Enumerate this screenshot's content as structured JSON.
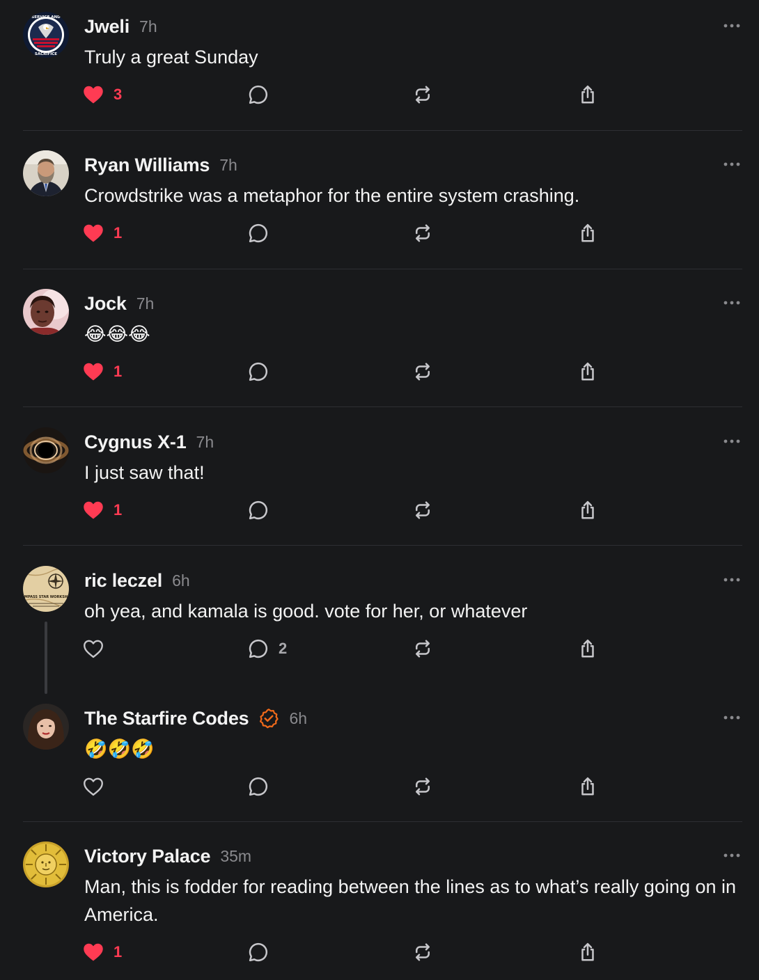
{
  "posts": [
    {
      "author": "Jweli",
      "time": "7h",
      "text": "Truly a great Sunday",
      "avatar_icon": "service-and-sacrifice-eagle-badge",
      "avatar_text": "SERVICE AND SACRIFICE",
      "liked": true,
      "likes": "3",
      "replies": "",
      "verified": false
    },
    {
      "author": "Ryan Williams",
      "time": "7h",
      "text": "Crowdstrike was a metaphor for the entire system crashing.",
      "avatar_icon": "bearded-man-photo",
      "liked": true,
      "likes": "1",
      "replies": "",
      "verified": false
    },
    {
      "author": "Jock",
      "time": "7h",
      "text": "😂😂😂",
      "avatar_icon": "portrait-photo",
      "liked": true,
      "likes": "1",
      "replies": "",
      "verified": false
    },
    {
      "author": "Cygnus X-1",
      "time": "7h",
      "text": "I just saw that!",
      "avatar_icon": "black-hole-image",
      "liked": true,
      "likes": "1",
      "replies": "",
      "verified": false
    },
    {
      "author": "ric leczel",
      "time": "6h",
      "text": "oh yea, and kamala is good. vote for her, or whatever",
      "avatar_icon": "compass-star-map",
      "avatar_text": "COMPASS STAR WORKSHOP",
      "liked": false,
      "likes": "",
      "replies": "2",
      "verified": false
    },
    {
      "author": "The Starfire Codes",
      "time": "6h",
      "text": "🤣🤣🤣",
      "avatar_icon": "woman-selfie-photo",
      "liked": false,
      "likes": "",
      "replies": "",
      "verified": true
    },
    {
      "author": "Victory Palace",
      "time": "35m",
      "text": "Man, this is fodder for reading between the lines as to what’s really going on in America.",
      "avatar_icon": "golden-sun-face",
      "liked": true,
      "likes": "1",
      "replies": "",
      "verified": false
    }
  ],
  "icons": {
    "like": "heart-icon",
    "reply": "speech-bubble-icon",
    "repost": "repost-arrows-icon",
    "share": "share-icon",
    "more": "more-dots-icon",
    "verified": "verified-badge-icon"
  },
  "colors": {
    "background": "#18191b",
    "text": "#f3f3f3",
    "muted": "#8a8a8e",
    "like_red": "#ff3b53",
    "verified_orange": "#f06a1a",
    "divider": "#2e2f33"
  }
}
